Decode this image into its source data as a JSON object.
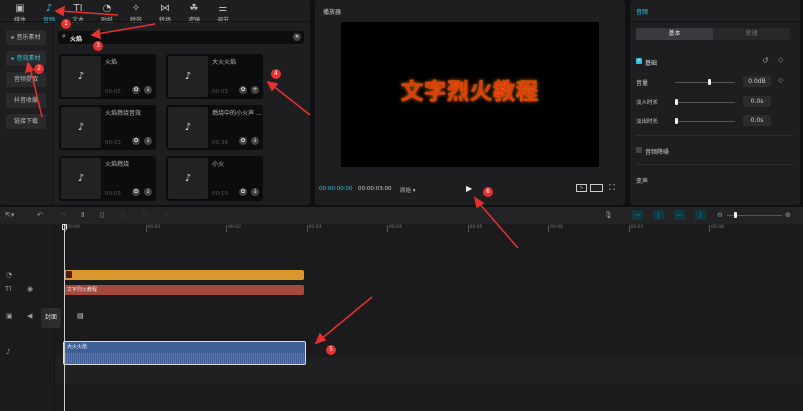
{
  "top_tabs": [
    {
      "label": "媒体",
      "icon": "▣"
    },
    {
      "label": "音频",
      "icon": "♪"
    },
    {
      "label": "文本",
      "icon": "TI"
    },
    {
      "label": "贴纸",
      "icon": "◔"
    },
    {
      "label": "特效",
      "icon": "✧"
    },
    {
      "label": "转场",
      "icon": "⋈"
    },
    {
      "label": "滤镜",
      "icon": "☘"
    },
    {
      "label": "调节",
      "icon": "⚌"
    }
  ],
  "sidebar": [
    "音乐素材",
    "音效素材",
    "音频提取",
    "抖音收藏",
    "链接下载"
  ],
  "search": {
    "value": "火焰"
  },
  "cards": [
    {
      "name": "火焰",
      "dur": "00:05"
    },
    {
      "name": "大火火焰",
      "dur": "00:03"
    },
    {
      "name": "火焰燃烧音效",
      "dur": "00:03"
    },
    {
      "name": "燃烧中的小火声 ...",
      "dur": "00:39"
    },
    {
      "name": "火焰燃烧",
      "dur": "00:03"
    },
    {
      "name": "小火",
      "dur": "00:19"
    }
  ],
  "player": {
    "title": "播放器",
    "preview_text": "文字烈火教程",
    "current": "00:00:00:00",
    "total": "00:00:03:00",
    "ratio": "原始"
  },
  "audio_panel": {
    "title": "音频",
    "tabs": [
      "基本",
      "变速"
    ],
    "basic": "基础",
    "volume_label": "音量",
    "volume": "0.0dB",
    "fade_in_label": "淡入时长",
    "fade_in": "0.0s",
    "fade_out_label": "淡出时长",
    "fade_out": "0.0s",
    "denoise": "音频降噪",
    "voice_change": "变声"
  },
  "timeline": {
    "ruler": [
      "00:00",
      "00:01",
      "00:02",
      "00:03",
      "00:04",
      "00:05",
      "00:06",
      "00:07",
      "00:08"
    ],
    "text_clip": "文字烈火教程",
    "cover": "封面",
    "audio_clip": "大火火焰"
  },
  "annotations": [
    "1",
    "2",
    "3",
    "4",
    "5",
    "6"
  ],
  "colors": {
    "accent": "#2ec4d6",
    "annotation": "#e5312f",
    "effect_clip": "#d9982b",
    "text_clip": "#a5493b",
    "audio_clip": "#3f5f96"
  }
}
